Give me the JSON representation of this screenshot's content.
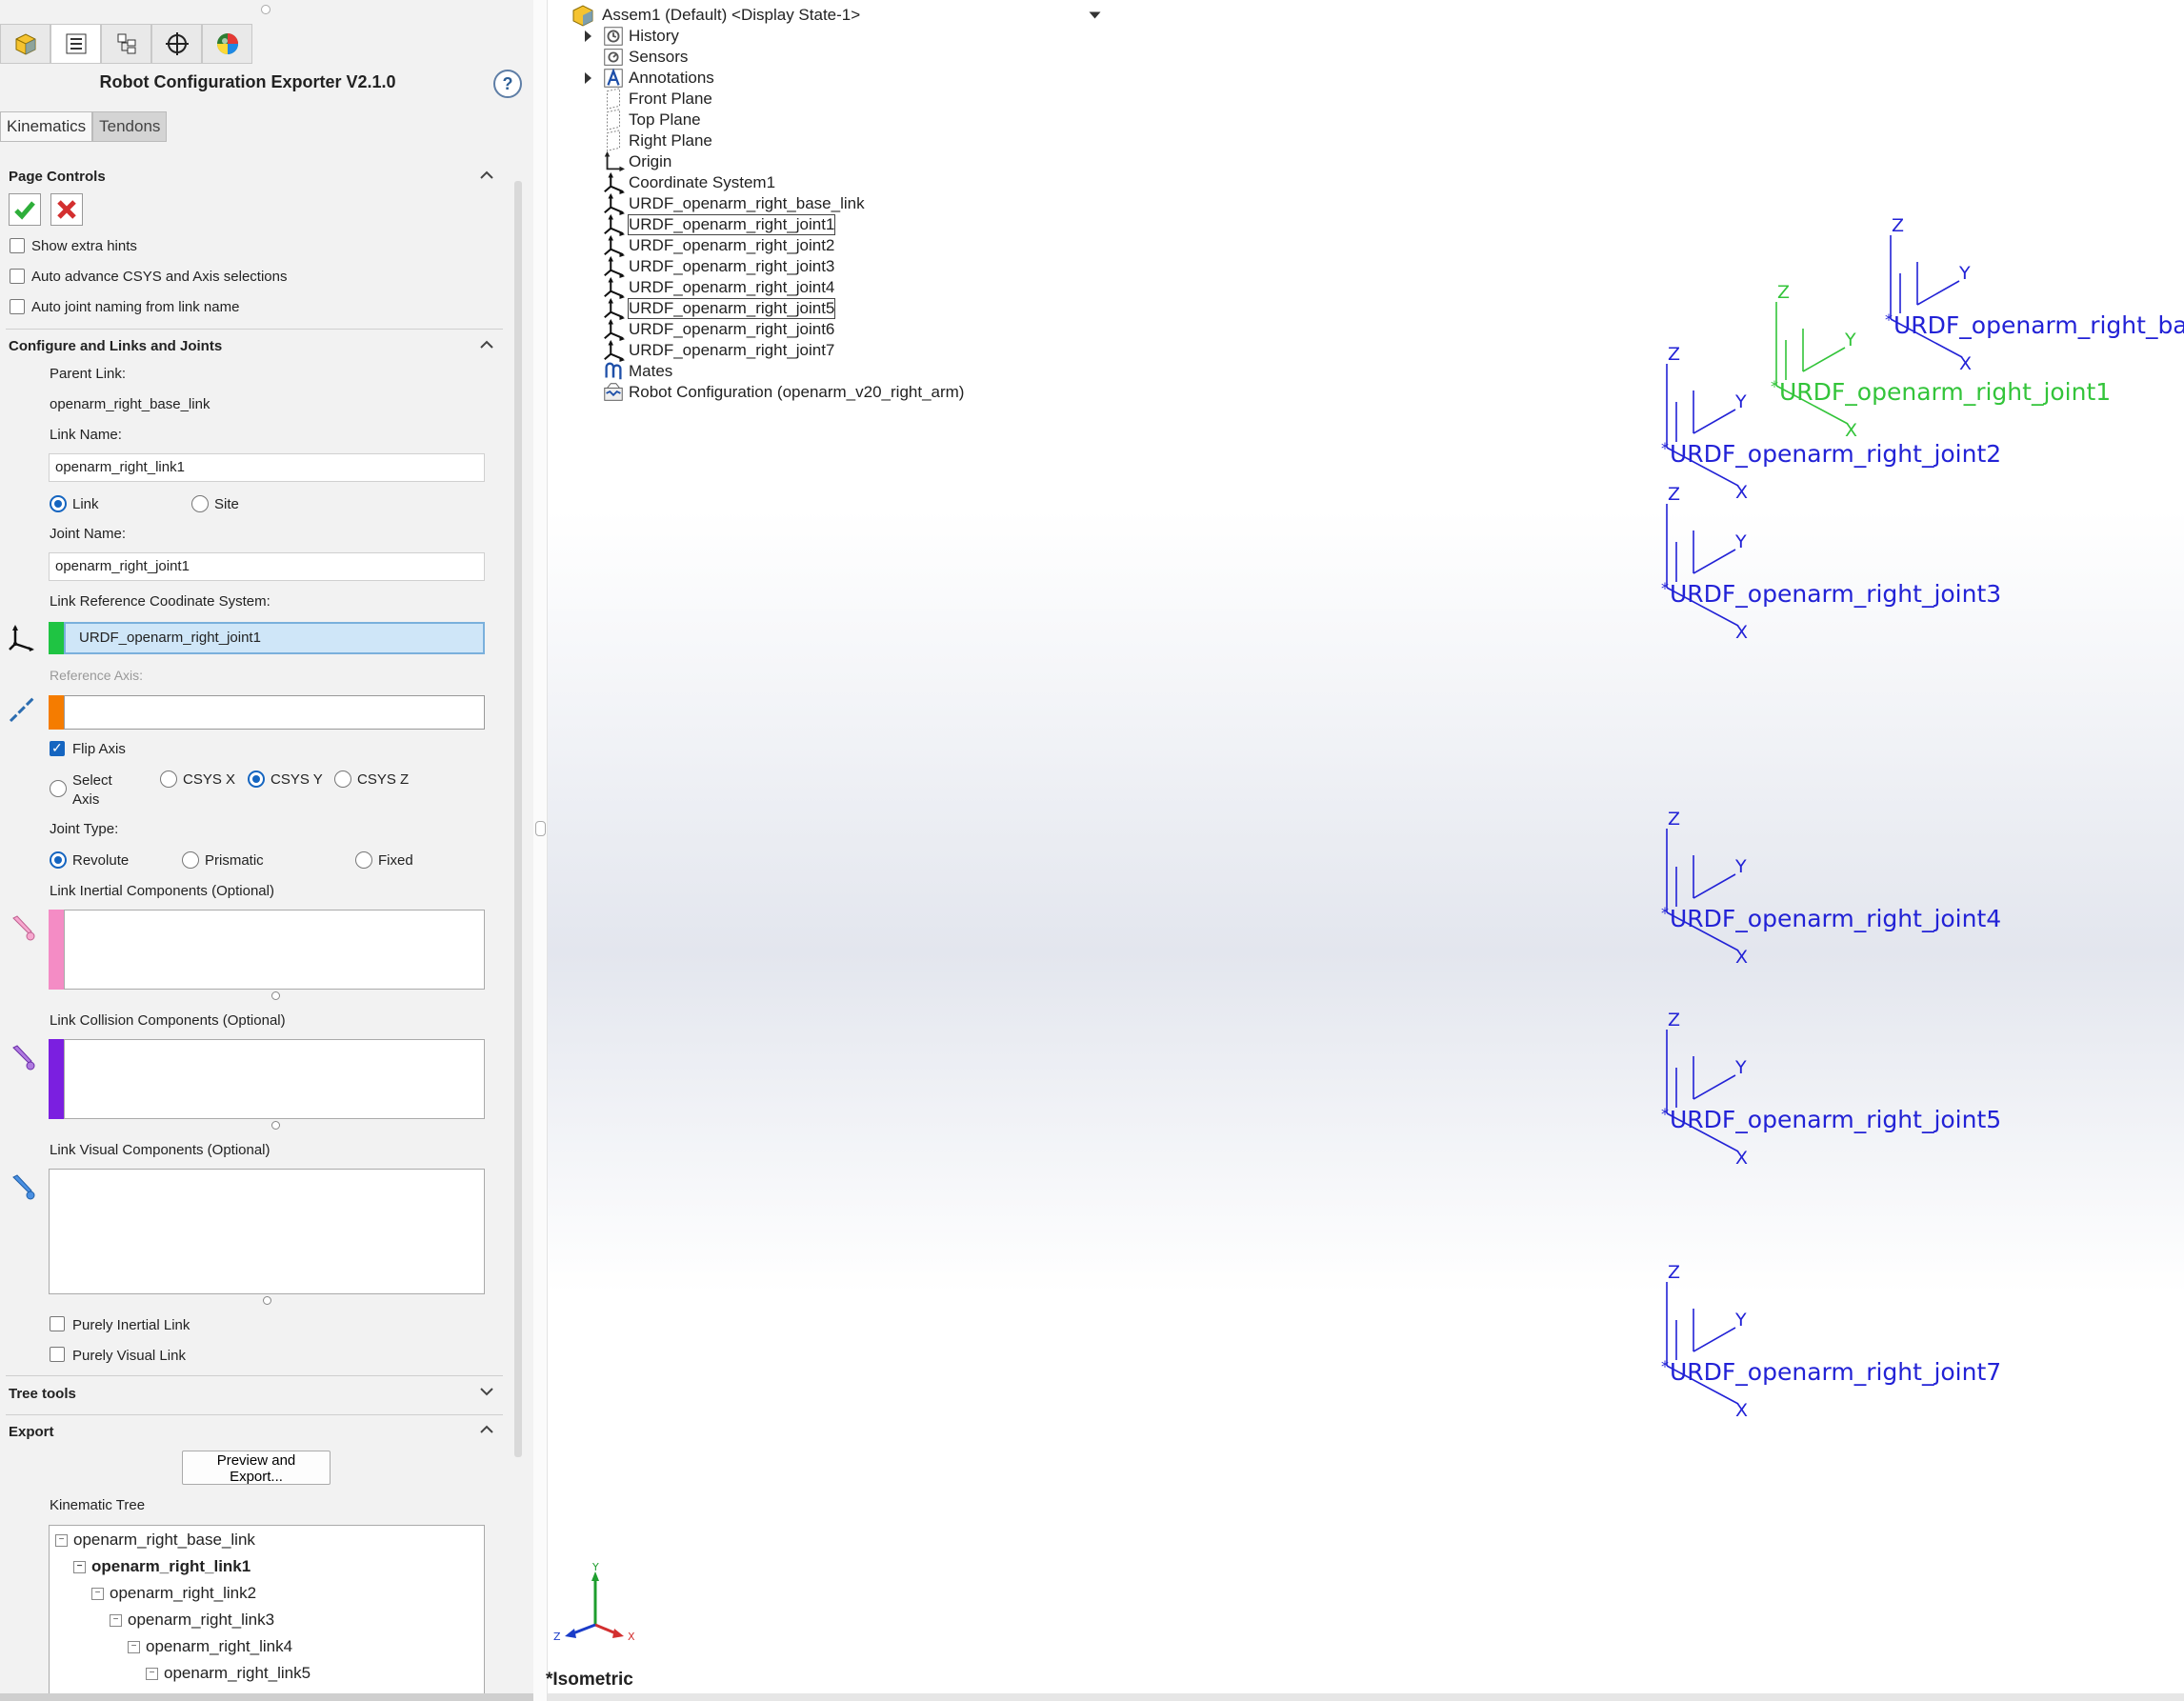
{
  "panel": {
    "title": "Robot Configuration Exporter V2.1.0",
    "help_icon": "?",
    "tabs": [
      "Kinematics",
      "Tendons"
    ],
    "page_controls": {
      "header": "Page Controls",
      "checkboxes": [
        {
          "label": "Show extra hints",
          "checked": false
        },
        {
          "label": "Auto advance CSYS and Axis selections",
          "checked": false
        },
        {
          "label": "Auto joint naming from link name",
          "checked": false
        }
      ]
    },
    "configure": {
      "header": "Configure and Links and Joints",
      "parent_link_label": "Parent Link:",
      "parent_link_value": "openarm_right_base_link",
      "link_name_label": "Link Name:",
      "link_name_value": "openarm_right_link1",
      "link_type_options": [
        "Link",
        "Site"
      ],
      "link_type_selected": "Link",
      "joint_name_label": "Joint Name:",
      "joint_name_value": "openarm_right_joint1",
      "csys_label": "Link Reference Coodinate System:",
      "csys_value": "URDF_openarm_right_joint1",
      "axis_label": "Reference Axis:",
      "axis_value": "",
      "flip_axis_label": "Flip Axis",
      "flip_axis_checked": true,
      "axis_options": [
        "Select Axis",
        "CSYS X",
        "CSYS Y",
        "CSYS Z"
      ],
      "axis_selected": "CSYS Y",
      "joint_type_label": "Joint Type:",
      "joint_type_options": [
        "Revolute",
        "Prismatic",
        "Fixed"
      ],
      "joint_type_selected": "Revolute",
      "inertial_label": "Link Inertial Components (Optional)",
      "collision_label": "Link Collision Components (Optional)",
      "visual_label": "Link Visual Components (Optional)",
      "purely_inertial_label": "Purely Inertial Link",
      "purely_visual_label": "Purely Visual Link"
    },
    "tree_tools_header": "Tree tools",
    "export": {
      "header": "Export",
      "preview_button": "Preview and Export...",
      "kinematic_tree_label": "Kinematic Tree",
      "tree": [
        {
          "label": "openarm_right_base_link",
          "bold": false
        },
        {
          "label": "openarm_right_link1",
          "bold": true
        },
        {
          "label": "openarm_right_link2",
          "bold": false
        },
        {
          "label": "openarm_right_link3",
          "bold": false
        },
        {
          "label": "openarm_right_link4",
          "bold": false
        },
        {
          "label": "openarm_right_link5",
          "bold": false
        }
      ]
    },
    "colors": {
      "csys": "#1fc443",
      "axis": "#f57c00",
      "inertial": "#f48cc5",
      "collision": "#7b1fe0",
      "selection": "#cfe6f8"
    }
  },
  "feature_tree": {
    "root": "Assem1 (Default) <Display State-1>",
    "items": [
      {
        "label": "History",
        "icon": "history-icon",
        "expandable": true
      },
      {
        "label": "Sensors",
        "icon": "sensors-icon",
        "expandable": false
      },
      {
        "label": "Annotations",
        "icon": "annotations-icon",
        "expandable": true
      },
      {
        "label": "Front Plane",
        "icon": "plane-icon",
        "expandable": false
      },
      {
        "label": "Top Plane",
        "icon": "plane-icon",
        "expandable": false
      },
      {
        "label": "Right Plane",
        "icon": "plane-icon",
        "expandable": false
      },
      {
        "label": "Origin",
        "icon": "origin-icon",
        "expandable": false
      },
      {
        "label": "Coordinate System1",
        "icon": "csys-icon",
        "expandable": false
      },
      {
        "label": "URDF_openarm_right_base_link",
        "icon": "csys-icon",
        "expandable": false
      },
      {
        "label": "URDF_openarm_right_joint1",
        "icon": "csys-icon",
        "expandable": false,
        "selected": true
      },
      {
        "label": "URDF_openarm_right_joint2",
        "icon": "csys-icon",
        "expandable": false
      },
      {
        "label": "URDF_openarm_right_joint3",
        "icon": "csys-icon",
        "expandable": false
      },
      {
        "label": "URDF_openarm_right_joint4",
        "icon": "csys-icon",
        "expandable": false
      },
      {
        "label": "URDF_openarm_right_joint5",
        "icon": "csys-icon",
        "expandable": false,
        "selected": true
      },
      {
        "label": "URDF_openarm_right_joint6",
        "icon": "csys-icon",
        "expandable": false
      },
      {
        "label": "URDF_openarm_right_joint7",
        "icon": "csys-icon",
        "expandable": false
      },
      {
        "label": "Mates",
        "icon": "mates-icon",
        "expandable": false
      },
      {
        "label": "Robot Configuration (openarm_v20_right_arm)",
        "icon": "robot-config-icon",
        "expandable": false
      }
    ]
  },
  "viewport": {
    "view_name": "*Isometric",
    "axis_letters": {
      "x": "X",
      "y": "Y",
      "z": "Z"
    },
    "csys_markers": [
      {
        "name": "URDF_openarm_right_base_link",
        "color": "#2222d6"
      },
      {
        "name": "URDF_openarm_right_joint1",
        "color": "#33c43a"
      },
      {
        "name": "URDF_openarm_right_joint2",
        "color": "#2222d6"
      },
      {
        "name": "URDF_openarm_right_joint3",
        "color": "#2222d6"
      },
      {
        "name": "URDF_openarm_right_joint4",
        "color": "#2222d6"
      },
      {
        "name": "URDF_openarm_right_joint5",
        "color": "#2222d6"
      },
      {
        "name": "URDF_openarm_right_joint7",
        "color": "#2222d6"
      }
    ],
    "triad": {
      "x": "X",
      "y": "Y",
      "z": "Z"
    }
  }
}
